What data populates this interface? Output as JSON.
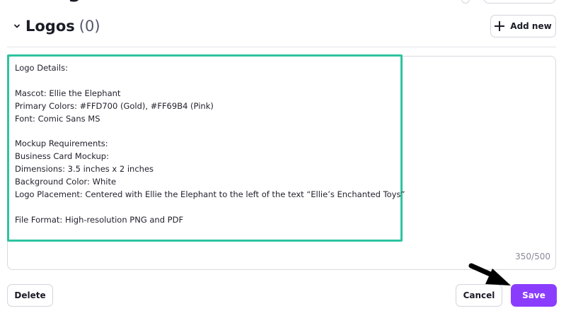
{
  "header_cutoff": {
    "title_fragment": "g"
  },
  "section": {
    "title": "Logos",
    "count": "(0)",
    "add_new_label": "Add new"
  },
  "textarea": {
    "lines": [
      "Logo Details:",
      "",
      "Mascot: Ellie the Elephant",
      "Primary Colors: #FFD700 (Gold), #FF69B4 (Pink)",
      "Font: Comic Sans MS",
      "",
      "Mockup Requirements:",
      "Business Card Mockup:",
      "Dimensions: 3.5 inches x 2 inches",
      "Background Color: White",
      "Logo Placement: Centered with Ellie the Elephant to the left of the text “Ellie’s Enchanted Toys”",
      "",
      "File Format: High-resolution PNG and PDF"
    ],
    "char_count": "350/500"
  },
  "footer": {
    "delete_label": "Delete",
    "cancel_label": "Cancel",
    "save_label": "Save"
  },
  "colors": {
    "highlight": "#2ec4a0",
    "save_button": "#8b3dff",
    "annotation_arrow": "#000000"
  },
  "icons": {
    "collapse": "chevron-down-icon",
    "add": "plus-icon",
    "annotation": "arrow-pointer-icon"
  }
}
